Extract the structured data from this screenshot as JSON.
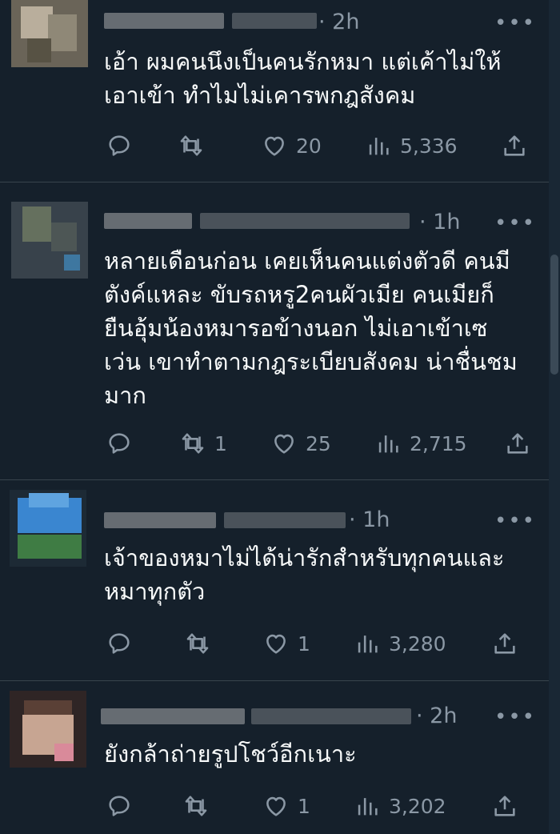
{
  "theme": {
    "background": "#15202b",
    "text": "#f7f9f9",
    "muted": "#8b98a5",
    "divider": "#38444d"
  },
  "icons": {
    "reply": "speech-bubble-icon",
    "retweet": "retweet-icon",
    "like": "heart-icon",
    "views": "bar-chart-icon",
    "share": "share-icon",
    "more": "more-dots-icon"
  },
  "replies": [
    {
      "time": "· 2h",
      "text": "เอ้า ผมคนนึงเป็นคนรักหมา แต่เค้าไม่ให้\nเอาเข้า ทำไมไม่เคารพกฎสังคม",
      "retweets": "",
      "likes": "20",
      "views": "5,336"
    },
    {
      "time": "· 1h",
      "text": "หลายเดือนก่อน เคยเห็นคนแต่งตัวดี คนมี\nตังค์แหละ ขับรถหรู2คนผัวเมีย  คนเมียก็\nยืนอุ้มน้องหมารอข้างนอก ไม่เอาเข้าเซ\nเว่น เขาทำตามกฎระเบียบสังคม น่าชื่นชม\nมาก",
      "retweets": "1",
      "likes": "25",
      "views": "2,715"
    },
    {
      "time": "· 1h",
      "text": "เจ้าของหมาไม่ได้น่ารักสำหรับทุกคนและ\nหมาทุกตัว",
      "retweets": "",
      "likes": "1",
      "views": "3,280"
    },
    {
      "time": "· 2h",
      "text": "ยังกล้าถ่ายรูปโชว์อีกเนาะ",
      "retweets": "",
      "likes": "1",
      "views": "3,202"
    }
  ],
  "more_label": "•••"
}
